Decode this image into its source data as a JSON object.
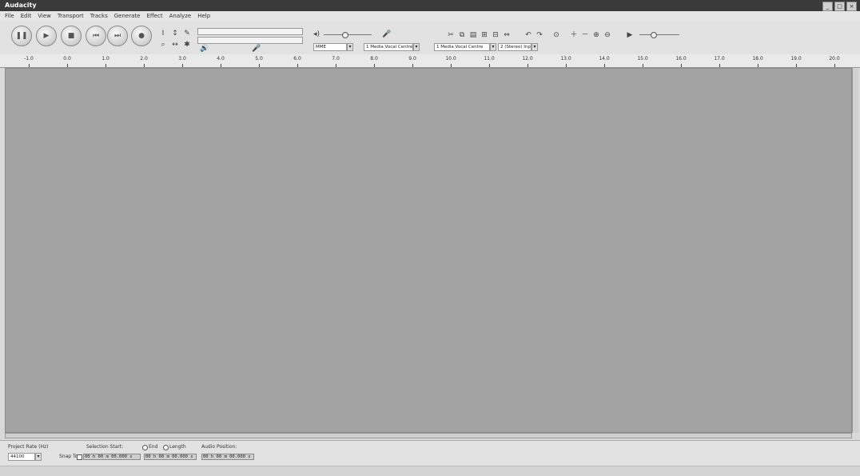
{
  "window": {
    "title": "Audacity",
    "min": "_",
    "max": "□",
    "close": "×"
  },
  "menu": [
    "File",
    "Edit",
    "View",
    "Transport",
    "Tracks",
    "Generate",
    "Effect",
    "Analyze",
    "Help"
  ],
  "transport": {
    "pause": "❚❚",
    "play": "▶",
    "stop": "■",
    "skip_start": "⏮",
    "skip_end": "⏭",
    "record": "●"
  },
  "tools": {
    "select": "I",
    "envelope": "↕",
    "draw": "✎",
    "zoom": "⌕",
    "timeshift": "↔",
    "multi": "✱"
  },
  "meters": {
    "playback_icon": "🔊",
    "record_icon": "🎤"
  },
  "mixer": {
    "output_label": "◂)",
    "input_label": "🎤"
  },
  "device": {
    "host": "MME",
    "playback": "1 Media Vocal Centre",
    "recording": "1 Media Vocal Centre",
    "channels": "2 (Stereo) Inp"
  },
  "ruler": {
    "labels": [
      "-1.0",
      "0.0",
      "1.0",
      "2.0",
      "3.0",
      "4.0",
      "5.0",
      "6.0",
      "7.0",
      "8.0",
      "9.0",
      "10.0",
      "11.0",
      "12.0",
      "13.0",
      "14.0",
      "15.0",
      "16.0",
      "17.0",
      "18.0",
      "19.0",
      "20.0"
    ]
  },
  "status": {
    "project_rate_label": "Project Rate (Hz)",
    "project_rate_value": "44100",
    "selection_start_label": "Selection Start:",
    "end_label": "End",
    "length_label": "Length",
    "audio_position_label": "Audio Position:",
    "snap_to_label": "Snap To",
    "selection_start_time": "00 h 00 m 00.000 s",
    "selection_end_time": "00 h 00 m 00.000 s",
    "audio_position_time": "00 h 00 m 00.000 s"
  }
}
